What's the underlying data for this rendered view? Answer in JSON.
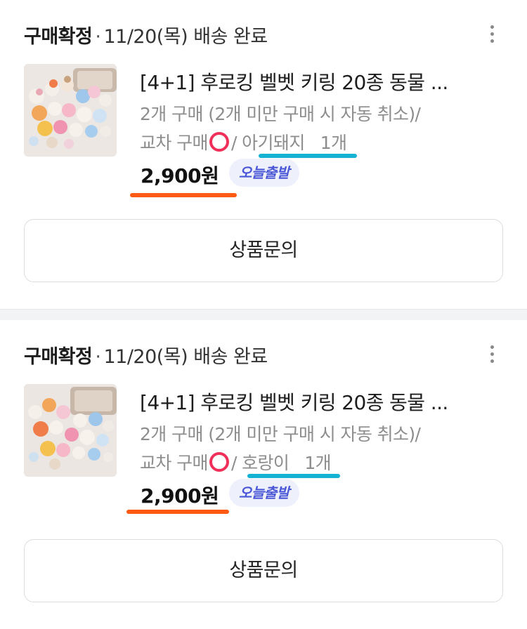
{
  "orders": [
    {
      "status": "구매확정",
      "separator": "·",
      "delivery": "11/20(목) 배송 완료",
      "title": "[4+1] 후로킹 벨벳 키링 20종 동물 ...",
      "option_line1": "2개 구매 (2개 미만 구매 시 자동 취소)/",
      "option_prefix": "교차 구매",
      "option_mark_icon": "red-circle-icon",
      "option_name": "/ 아기돼지",
      "quantity": "1개",
      "price": "2,900원",
      "badge": "오늘출발",
      "inquiry_button": "상품문의"
    },
    {
      "status": "구매확정",
      "separator": "·",
      "delivery": "11/20(목) 배송 완료",
      "title": "[4+1] 후로킹 벨벳 키링 20종 동물 ...",
      "option_line1": "2개 구매 (2개 미만 구매 시 자동 취소)/",
      "option_prefix": "교차 구매",
      "option_mark_icon": "red-circle-icon",
      "option_name": "/ 호랑이",
      "quantity": "1개",
      "price": "2,900원",
      "badge": "오늘출발",
      "inquiry_button": "상품문의"
    }
  ],
  "colors": {
    "annotation_blue": "#14b2d3",
    "annotation_orange": "#ff5a14",
    "badge_text": "#4a57d6",
    "badge_bg": "#eef0fb",
    "option_mark": "#f0305a"
  }
}
